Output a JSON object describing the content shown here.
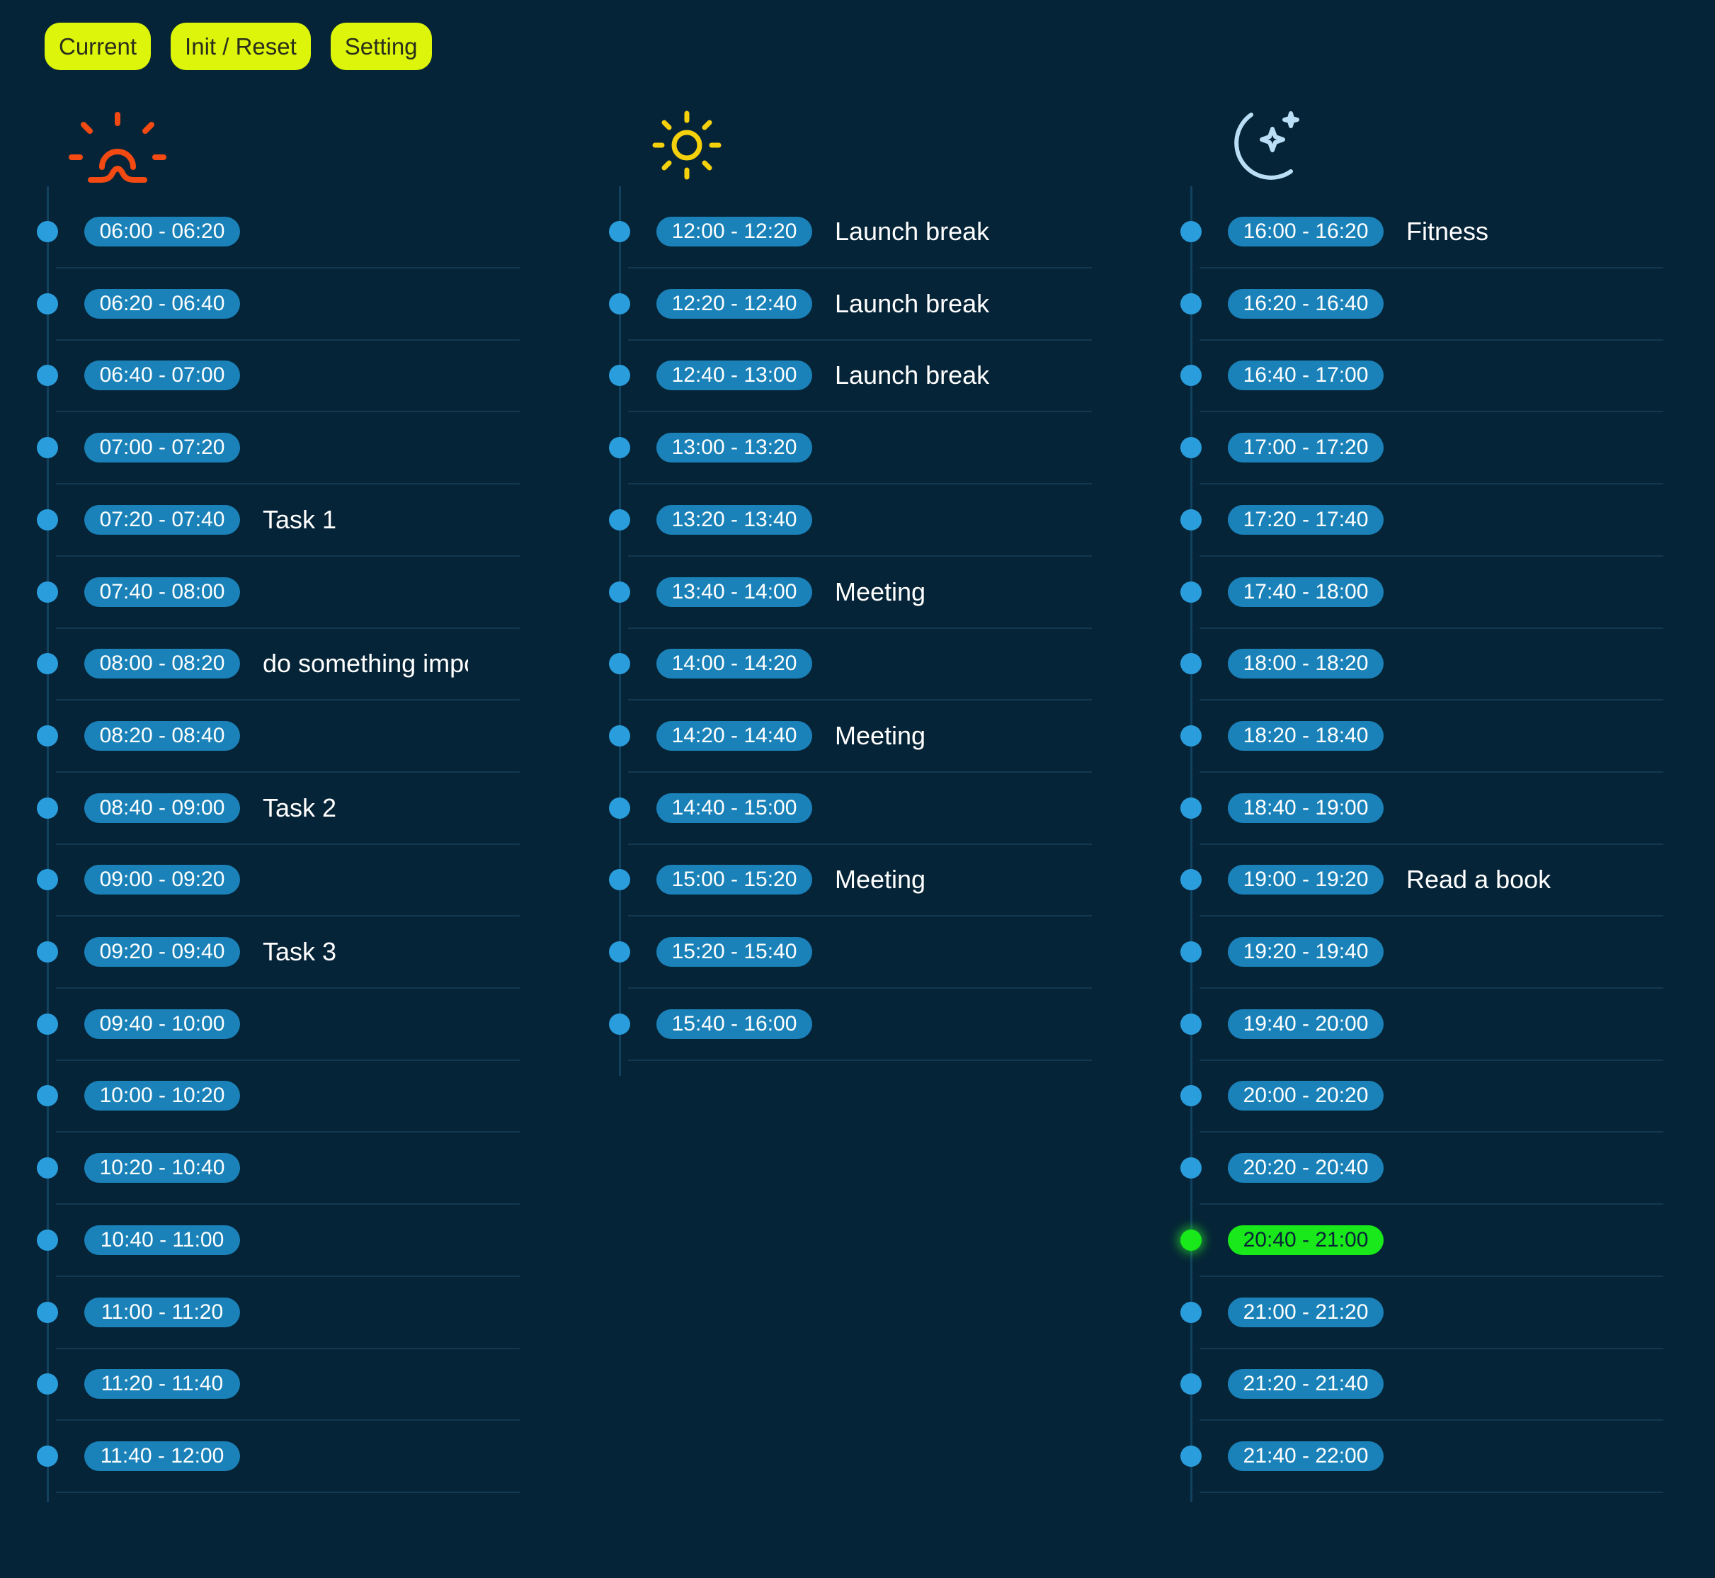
{
  "toolbar": {
    "current_label": "Current",
    "reset_label": "Init / Reset",
    "setting_label": "Setting"
  },
  "colors": {
    "background": "#062437",
    "button": "#dcf50a",
    "time_pill": "#1a82b9",
    "dot": "#2a9ddc",
    "current_highlight": "#19e81a",
    "sunrise_icon": "#f24a12",
    "sun_icon": "#f5d10c",
    "moon_icon": "#b9def5"
  },
  "columns": [
    {
      "icon": "sunrise-icon",
      "slots": [
        {
          "range": "06:00 - 06:20",
          "task": ""
        },
        {
          "range": "06:20 - 06:40",
          "task": ""
        },
        {
          "range": "06:40 - 07:00",
          "task": ""
        },
        {
          "range": "07:00 - 07:20",
          "task": ""
        },
        {
          "range": "07:20 - 07:40",
          "task": "Task 1"
        },
        {
          "range": "07:40 - 08:00",
          "task": ""
        },
        {
          "range": "08:00 - 08:20",
          "task": "do something impo"
        },
        {
          "range": "08:20 - 08:40",
          "task": ""
        },
        {
          "range": "08:40 - 09:00",
          "task": "Task 2"
        },
        {
          "range": "09:00 - 09:20",
          "task": ""
        },
        {
          "range": "09:20 - 09:40",
          "task": "Task 3"
        },
        {
          "range": "09:40 - 10:00",
          "task": ""
        },
        {
          "range": "10:00 - 10:20",
          "task": ""
        },
        {
          "range": "10:20 - 10:40",
          "task": ""
        },
        {
          "range": "10:40 - 11:00",
          "task": ""
        },
        {
          "range": "11:00 - 11:20",
          "task": ""
        },
        {
          "range": "11:20 - 11:40",
          "task": ""
        },
        {
          "range": "11:40 - 12:00",
          "task": ""
        }
      ]
    },
    {
      "icon": "sun-icon",
      "slots": [
        {
          "range": "12:00 - 12:20",
          "task": "Launch break"
        },
        {
          "range": "12:20 - 12:40",
          "task": "Launch break"
        },
        {
          "range": "12:40 - 13:00",
          "task": "Launch break"
        },
        {
          "range": "13:00 - 13:20",
          "task": ""
        },
        {
          "range": "13:20 - 13:40",
          "task": ""
        },
        {
          "range": "13:40 - 14:00",
          "task": "Meeting"
        },
        {
          "range": "14:00 - 14:20",
          "task": ""
        },
        {
          "range": "14:20 - 14:40",
          "task": "Meeting"
        },
        {
          "range": "14:40 - 15:00",
          "task": ""
        },
        {
          "range": "15:00 - 15:20",
          "task": "Meeting"
        },
        {
          "range": "15:20 - 15:40",
          "task": ""
        },
        {
          "range": "15:40 - 16:00",
          "task": ""
        }
      ]
    },
    {
      "icon": "moon-stars-icon",
      "slots": [
        {
          "range": "16:00 - 16:20",
          "task": "Fitness"
        },
        {
          "range": "16:20 - 16:40",
          "task": ""
        },
        {
          "range": "16:40 - 17:00",
          "task": ""
        },
        {
          "range": "17:00 - 17:20",
          "task": ""
        },
        {
          "range": "17:20 - 17:40",
          "task": ""
        },
        {
          "range": "17:40 - 18:00",
          "task": ""
        },
        {
          "range": "18:00 - 18:20",
          "task": ""
        },
        {
          "range": "18:20 - 18:40",
          "task": ""
        },
        {
          "range": "18:40 - 19:00",
          "task": ""
        },
        {
          "range": "19:00 - 19:20",
          "task": "Read a book"
        },
        {
          "range": "19:20 - 19:40",
          "task": ""
        },
        {
          "range": "19:40 - 20:00",
          "task": ""
        },
        {
          "range": "20:00 - 20:20",
          "task": ""
        },
        {
          "range": "20:20 - 20:40",
          "task": ""
        },
        {
          "range": "20:40 - 21:00",
          "task": "",
          "current": true
        },
        {
          "range": "21:00 - 21:20",
          "task": ""
        },
        {
          "range": "21:20 - 21:40",
          "task": ""
        },
        {
          "range": "21:40 - 22:00",
          "task": ""
        }
      ]
    }
  ]
}
